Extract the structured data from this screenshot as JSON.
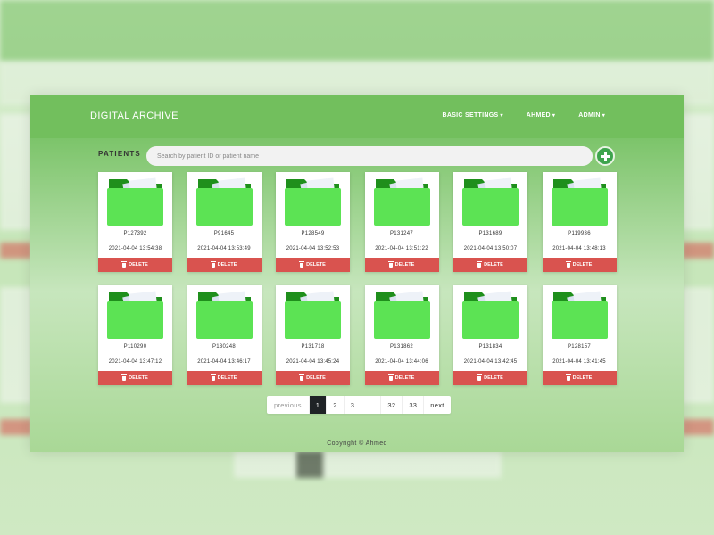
{
  "app": {
    "title": "DIGITAL ARCHIVE"
  },
  "nav": [
    {
      "label": "BASIC SETTINGS"
    },
    {
      "label": "AHMED"
    },
    {
      "label": "ADMIN"
    }
  ],
  "section": {
    "title": "PATIENTS"
  },
  "search": {
    "placeholder": "Search by patient ID or patient name",
    "value": ""
  },
  "patients": [
    {
      "id": "P127392",
      "date": "2021-04-04 13:54:38"
    },
    {
      "id": "P91645",
      "date": "2021-04-04 13:53:49"
    },
    {
      "id": "P128549",
      "date": "2021-04-04 13:52:53"
    },
    {
      "id": "P131247",
      "date": "2021-04-04 13:51:22"
    },
    {
      "id": "P131689",
      "date": "2021-04-04 13:50:07"
    },
    {
      "id": "P119936",
      "date": "2021-04-04 13:48:13"
    },
    {
      "id": "P110290",
      "date": "2021-04-04 13:47:12"
    },
    {
      "id": "P130248",
      "date": "2021-04-04 13:46:17"
    },
    {
      "id": "P131718",
      "date": "2021-04-04 13:45:24"
    },
    {
      "id": "P131862",
      "date": "2021-04-04 13:44:06"
    },
    {
      "id": "P131834",
      "date": "2021-04-04 13:42:45"
    },
    {
      "id": "P128157",
      "date": "2021-04-04 13:41:45"
    }
  ],
  "card": {
    "delete_label": "DELETE"
  },
  "pagination": {
    "previous": "previous",
    "pages": [
      "1",
      "2",
      "3",
      "...",
      "32",
      "33"
    ],
    "active": "1",
    "next": "next"
  },
  "footer": {
    "text": "Copyright © Ahmed"
  },
  "colors": {
    "brand_green": "#72bf5d",
    "folder_green": "#5ce354",
    "delete_red": "#d9534f",
    "add_button": "#3ea44d"
  }
}
